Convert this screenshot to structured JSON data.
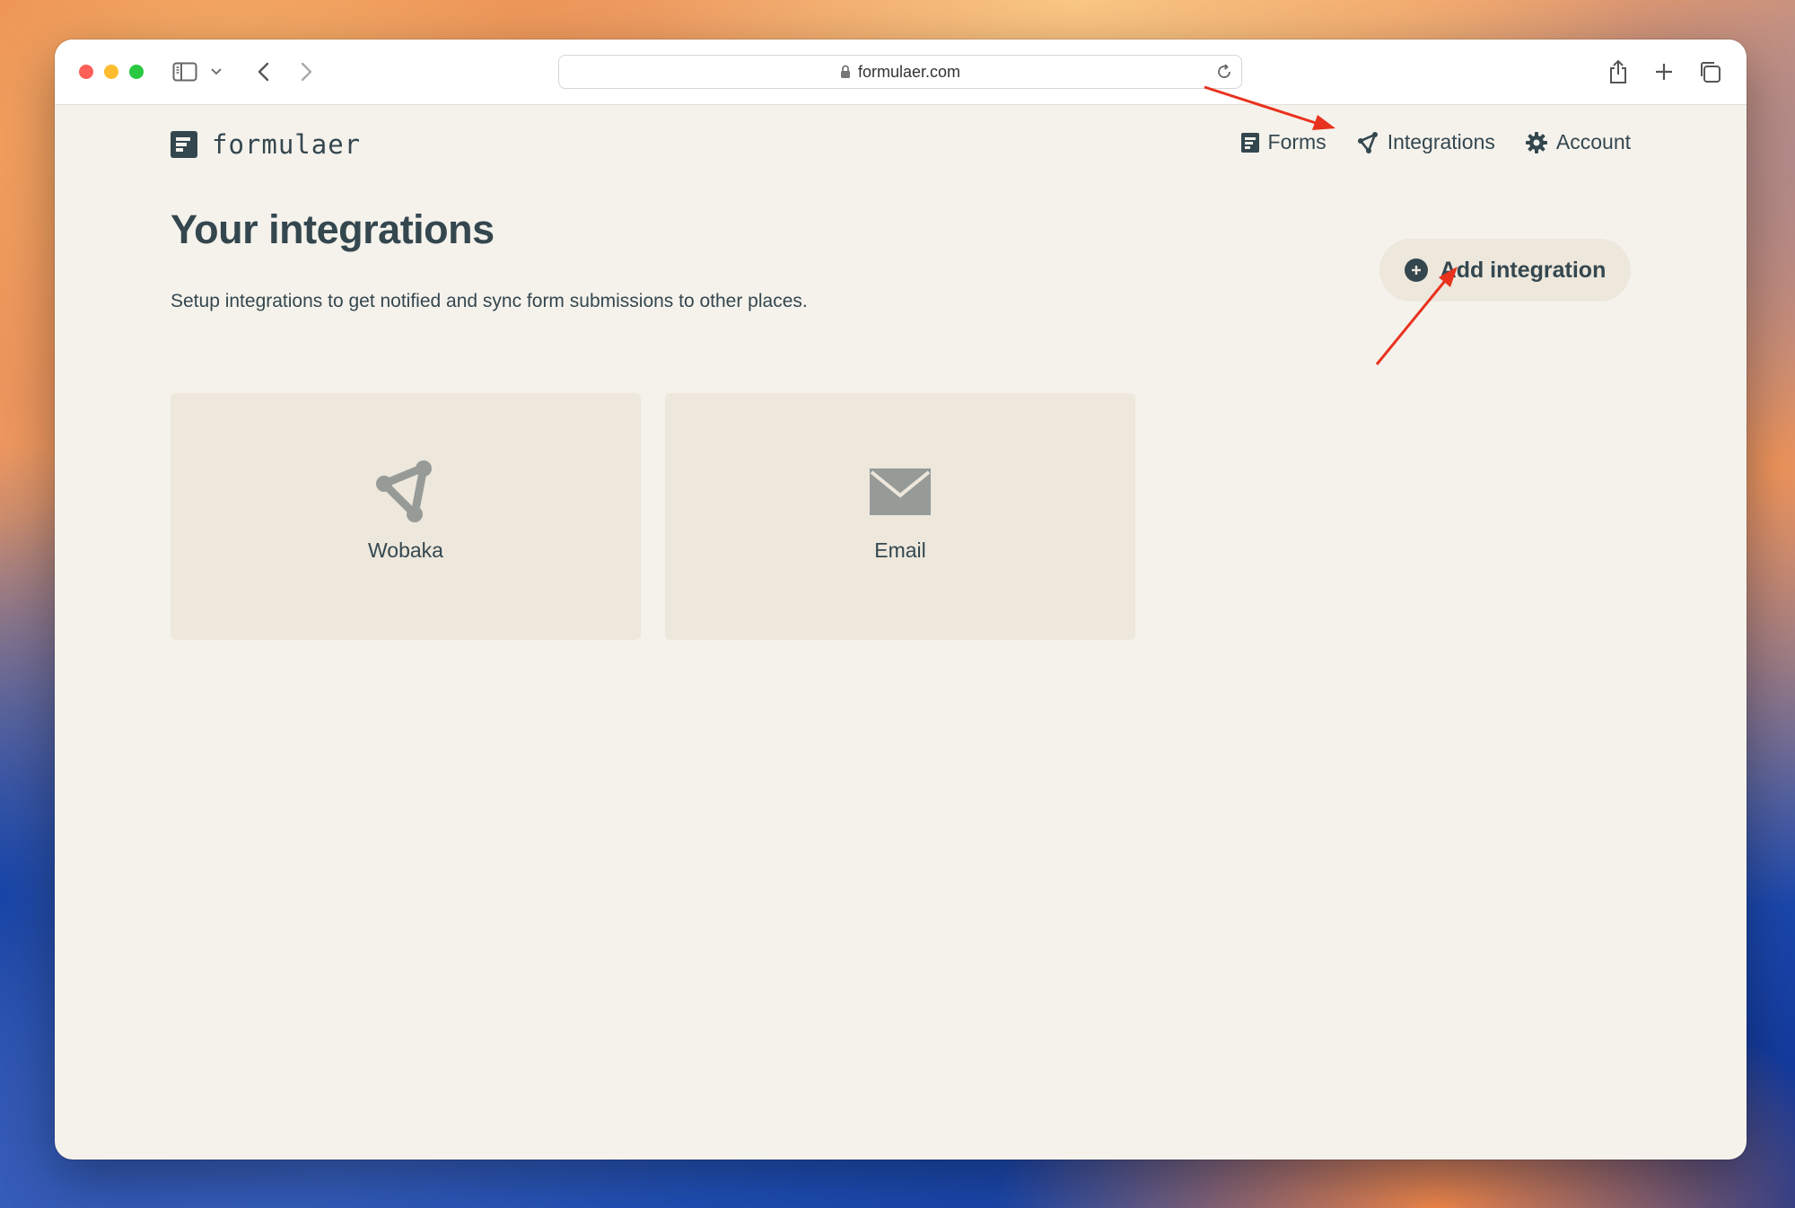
{
  "browser": {
    "url": "formulaer.com"
  },
  "app": {
    "logo_text": "formulaer"
  },
  "nav": {
    "items": [
      {
        "label": "Forms",
        "icon": "form-icon"
      },
      {
        "label": "Integrations",
        "icon": "integrations-icon"
      },
      {
        "label": "Account",
        "icon": "gear-icon"
      }
    ]
  },
  "main": {
    "title": "Your integrations",
    "subtitle": "Setup integrations to get notified and sync form submissions to other places.",
    "add_button_label": "Add integration",
    "integrations": [
      {
        "label": "Wobaka",
        "icon": "wobaka-icon"
      },
      {
        "label": "Email",
        "icon": "envelope-icon"
      }
    ]
  },
  "annotations": {
    "arrow_color": "#e8321e"
  },
  "colors": {
    "text": "#34474f",
    "page_bg": "#f5f2ec",
    "card_bg": "#ede7dc",
    "icon_gray": "#979b98"
  }
}
